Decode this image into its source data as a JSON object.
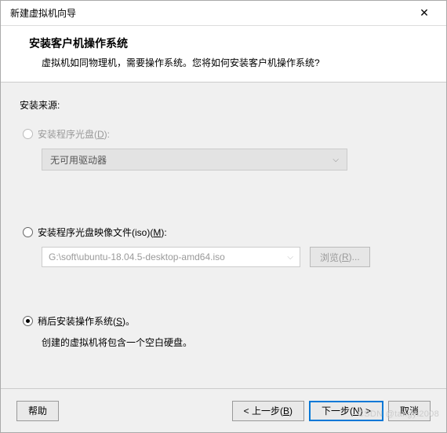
{
  "window": {
    "title": "新建虚拟机向导"
  },
  "header": {
    "title": "安装客户机操作系统",
    "subtitle": "虚拟机如同物理机，需要操作系统。您将如何安装客户机操作系统?"
  },
  "source": {
    "label": "安装来源:"
  },
  "opt1": {
    "label_pre": "安装程序光盘(",
    "label_key": "D",
    "label_post": "):",
    "dropdown": "无可用驱动器"
  },
  "opt2": {
    "label_pre": "安装程序光盘映像文件(iso)(",
    "label_key": "M",
    "label_post": "):",
    "path": "G:\\soft\\ubuntu-18.04.5-desktop-amd64.iso",
    "browse_pre": "浏览(",
    "browse_key": "R",
    "browse_post": ")..."
  },
  "opt3": {
    "label_pre": "稍后安装操作系统(",
    "label_key": "S",
    "label_post": ")。",
    "desc": "创建的虚拟机将包含一个空白硬盘。"
  },
  "footer": {
    "help": "帮助",
    "back_pre": "< 上一步(",
    "back_key": "B",
    "back_post": ")",
    "next_pre": "下一步(",
    "next_key": "N",
    "next_post": ") >",
    "cancel": "取消"
  },
  "watermark": "CSDN @tangyi2008"
}
